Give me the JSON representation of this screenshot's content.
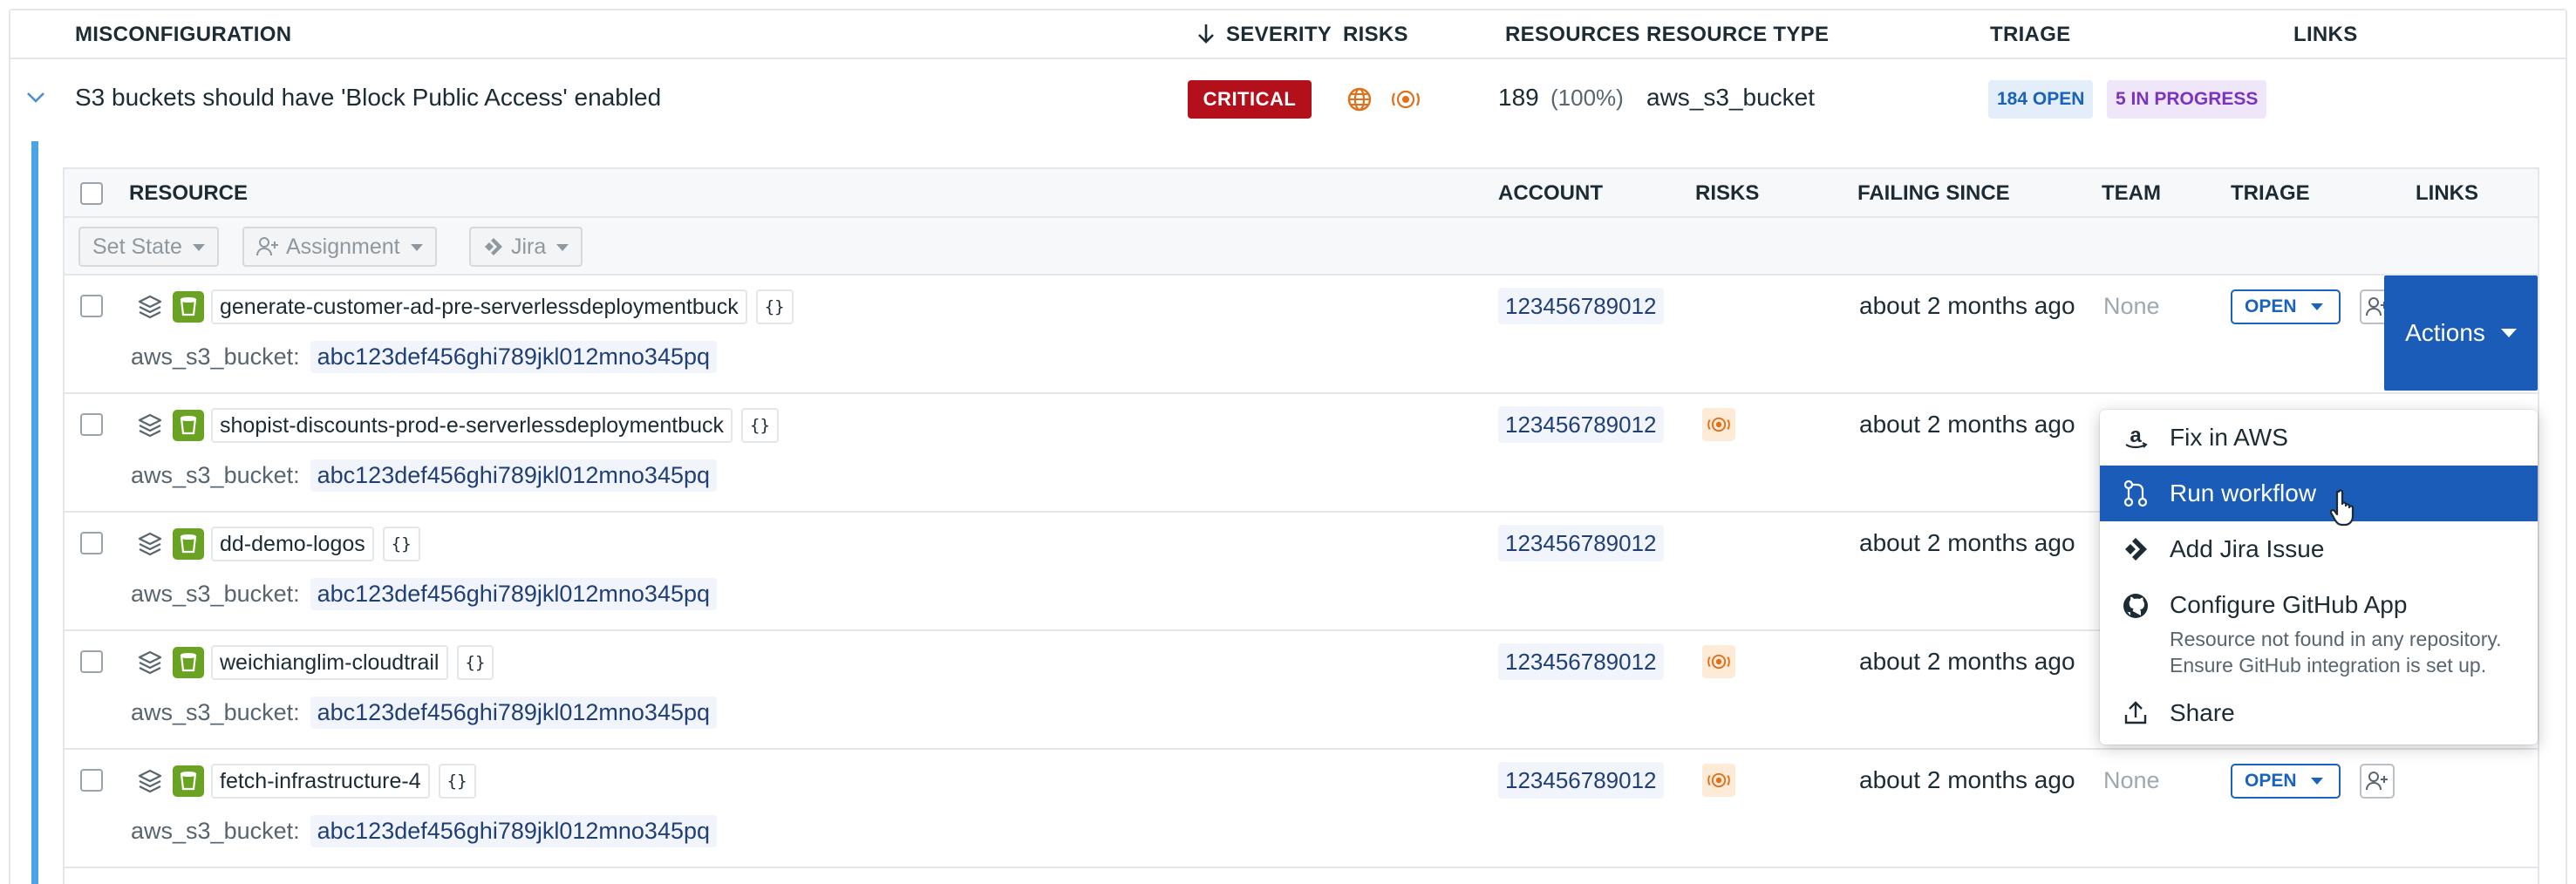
{
  "table": {
    "headers": {
      "misconfiguration": "MISCONFIGURATION",
      "severity": "SEVERITY",
      "risks": "RISKS",
      "resources": "RESOURCES",
      "resource_type": "RESOURCE TYPE",
      "triage": "TRIAGE",
      "links": "LINKS"
    }
  },
  "misconfig": {
    "title": "S3 buckets should have 'Block Public Access' enabled",
    "severity": "CRITICAL",
    "resources_count": "189",
    "resources_pct": "(100%)",
    "resource_type": "aws_s3_bucket",
    "triage_open": "184 OPEN",
    "triage_in_progress": "5 IN PROGRESS"
  },
  "inner": {
    "headers": {
      "resource": "RESOURCE",
      "account": "ACCOUNT",
      "risks": "RISKS",
      "failing_since": "FAILING SINCE",
      "team": "TEAM",
      "triage": "TRIAGE",
      "links": "LINKS"
    },
    "toolbar": {
      "set_state": "Set State",
      "assignment": "Assignment",
      "jira": "Jira"
    },
    "json_tag": "{}",
    "rows": [
      {
        "name": "generate-customer-ad-pre-serverlessdeploymentbuck",
        "type_label": "aws_s3_bucket:",
        "id": "abc123def456ghi789jkl012mno345pq",
        "account": "123456789012",
        "failing_since": "about 2 months ago",
        "team": "None",
        "triage": "OPEN"
      },
      {
        "name": "shopist-discounts-prod-e-serverlessdeploymentbuck",
        "type_label": "aws_s3_bucket:",
        "id": "abc123def456ghi789jkl012mno345pq",
        "account": "123456789012",
        "failing_since": "about 2 months ago"
      },
      {
        "name": "dd-demo-logos",
        "type_label": "aws_s3_bucket:",
        "id": "abc123def456ghi789jkl012mno345pq",
        "account": "123456789012",
        "failing_since": "about 2 months ago"
      },
      {
        "name": "weichianglim-cloudtrail",
        "type_label": "aws_s3_bucket:",
        "id": "abc123def456ghi789jkl012mno345pq",
        "account": "123456789012",
        "failing_since": "about 2 months ago"
      },
      {
        "name": "fetch-infrastructure-4",
        "type_label": "aws_s3_bucket:",
        "id": "abc123def456ghi789jkl012mno345pq",
        "account": "123456789012",
        "failing_since": "about 2 months ago",
        "team": "None",
        "triage": "OPEN"
      }
    ]
  },
  "actions": {
    "label": "Actions",
    "menu": [
      {
        "label": "Fix in AWS",
        "icon": "amazon-icon"
      },
      {
        "label": "Run workflow",
        "icon": "workflow-icon"
      },
      {
        "label": "Add Jira Issue",
        "icon": "jira-icon"
      },
      {
        "label": "Configure GitHub App",
        "icon": "github-icon",
        "sub1": "Resource not found in any repository.",
        "sub2": "Ensure GitHub integration is set up."
      },
      {
        "label": "Share",
        "icon": "share-icon"
      }
    ]
  },
  "colors": {
    "critical": "#b4101b",
    "accent_blue": "#1a5cb8",
    "open_blue": "#1a62ba",
    "in_progress_purple": "#7b33c2",
    "s3_green": "#6aa224",
    "risk_orange": "#e0701a",
    "expand_bar": "#4aa3e6"
  }
}
